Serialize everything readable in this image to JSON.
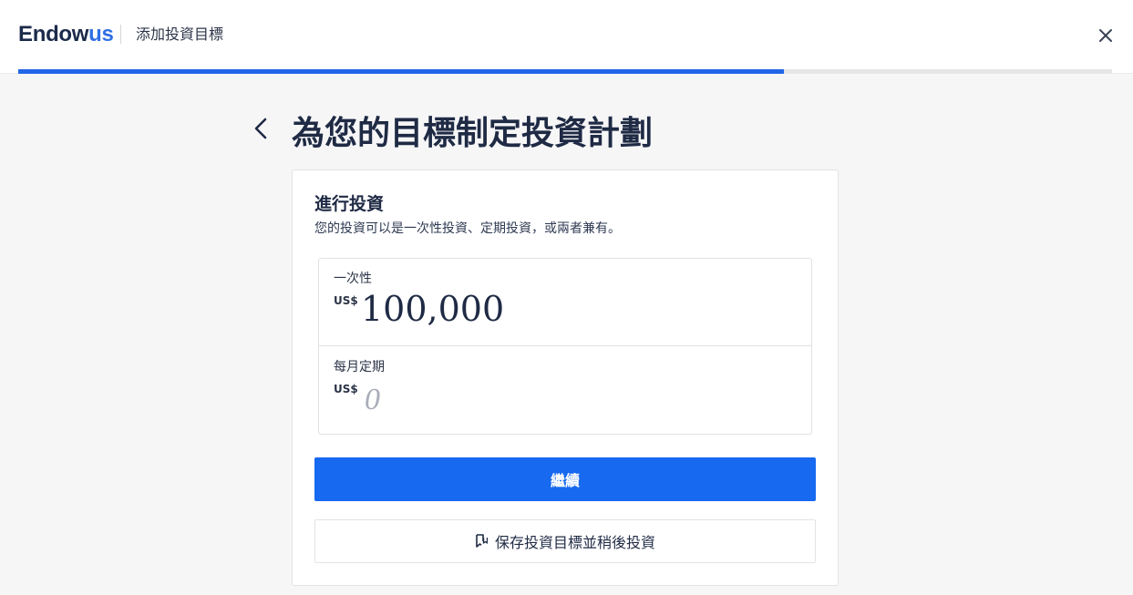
{
  "header": {
    "logo_text_dark": "Endow",
    "logo_text_accent": "us",
    "title": "添加投資目標",
    "close_icon": "close-icon"
  },
  "progress": {
    "fraction": 0.7,
    "fill_color": "#2166e8"
  },
  "page": {
    "back_icon": "chevron-left-icon",
    "title": "為您的目標制定投資計劃"
  },
  "card": {
    "title": "進行投資",
    "subtitle": "您的投資可以是一次性投資、定期投資，或兩者兼有。",
    "lump_sum": {
      "label": "一次性",
      "currency": "US$",
      "value": "100,000"
    },
    "monthly": {
      "label": "每月定期",
      "currency": "US$",
      "placeholder": "0"
    },
    "continue_label": "繼續",
    "save_later_label": "保存投資目標並稍後投資",
    "save_icon": "bookmark-icon"
  },
  "colors": {
    "brand_dark": "#1b2a4a",
    "brand_accent": "#2f6fe4",
    "primary_button": "#1769ef",
    "background": "#f6f6f7"
  }
}
